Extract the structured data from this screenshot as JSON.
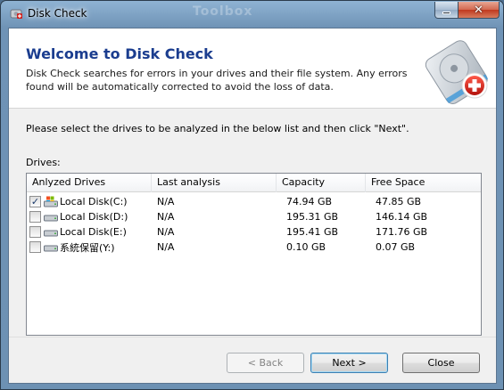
{
  "window": {
    "title": "Disk Check",
    "background_text": "Toolbox"
  },
  "header": {
    "title": "Welcome to Disk Check",
    "description": "Disk Check searches for errors in your drives and their file system. Any errors found will be automatically corrected to avoid the loss of data.",
    "logo_icon": "disk-repair-icon"
  },
  "instruction": "Please select the drives to be analyzed in the below list and then click \"Next\".",
  "drives_label": "Drives:",
  "table": {
    "columns": [
      "Anlyzed Drives",
      "Last analysis",
      "Capacity",
      "Free Space"
    ],
    "rows": [
      {
        "name": "Local Disk(C:)",
        "last": "N/A",
        "capacity": "74.94 GB",
        "free": "47.85 GB",
        "checked": true,
        "icon": "system-drive-icon"
      },
      {
        "name": "Local Disk(D:)",
        "last": "N/A",
        "capacity": "195.31 GB",
        "free": "146.14 GB",
        "checked": false,
        "icon": "hard-drive-icon"
      },
      {
        "name": "Local Disk(E:)",
        "last": "N/A",
        "capacity": "195.41 GB",
        "free": "171.76 GB",
        "checked": false,
        "icon": "hard-drive-icon"
      },
      {
        "name": "系統保留(Y:)",
        "last": "N/A",
        "capacity": "0.10 GB",
        "free": "0.07 GB",
        "checked": false,
        "icon": "hard-drive-icon"
      }
    ]
  },
  "buttons": {
    "back": "< Back",
    "next": "Next >",
    "close": "Close"
  },
  "colors": {
    "title_blue": "#1b3d8f",
    "accent_red": "#d0201c"
  }
}
